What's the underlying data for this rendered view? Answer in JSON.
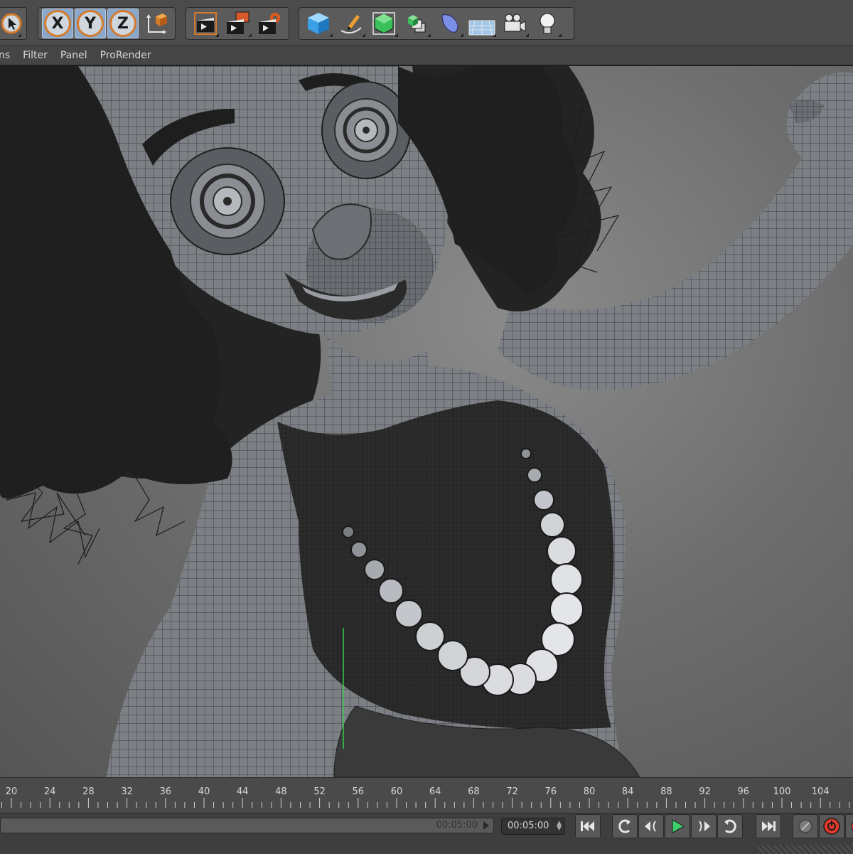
{
  "toolbar": {
    "axis_labels": [
      "X",
      "Y",
      "Z"
    ],
    "icons": [
      "select-arrow-icon",
      "coordinate-system-icon",
      "render-region-icon",
      "render-view-icon",
      "render-settings-icon",
      "cube-primitive-icon",
      "pen-spline-icon",
      "subdivision-surface-icon",
      "cloner-icon",
      "deformer-icon",
      "floor-environment-icon",
      "camera-icon",
      "light-bulb-icon"
    ]
  },
  "menu": {
    "items": [
      "ns",
      "Filter",
      "Panel",
      "ProRender"
    ]
  },
  "viewport": {
    "subject": "wireframe-character"
  },
  "timeline": {
    "ticks": [
      "20",
      "24",
      "28",
      "32",
      "36",
      "40",
      "44",
      "48",
      "52",
      "56",
      "60",
      "64",
      "68",
      "72",
      "76",
      "80",
      "84",
      "88",
      "92",
      "96",
      "100",
      "104"
    ],
    "scrub_value": "00:05:00",
    "current_time": "00:05:00"
  },
  "colors": {
    "accent_orange": "#d57a2a",
    "active_blue": "#8aa6c8",
    "play_green": "#3ccf6a",
    "record_red": "#e03a2a"
  }
}
